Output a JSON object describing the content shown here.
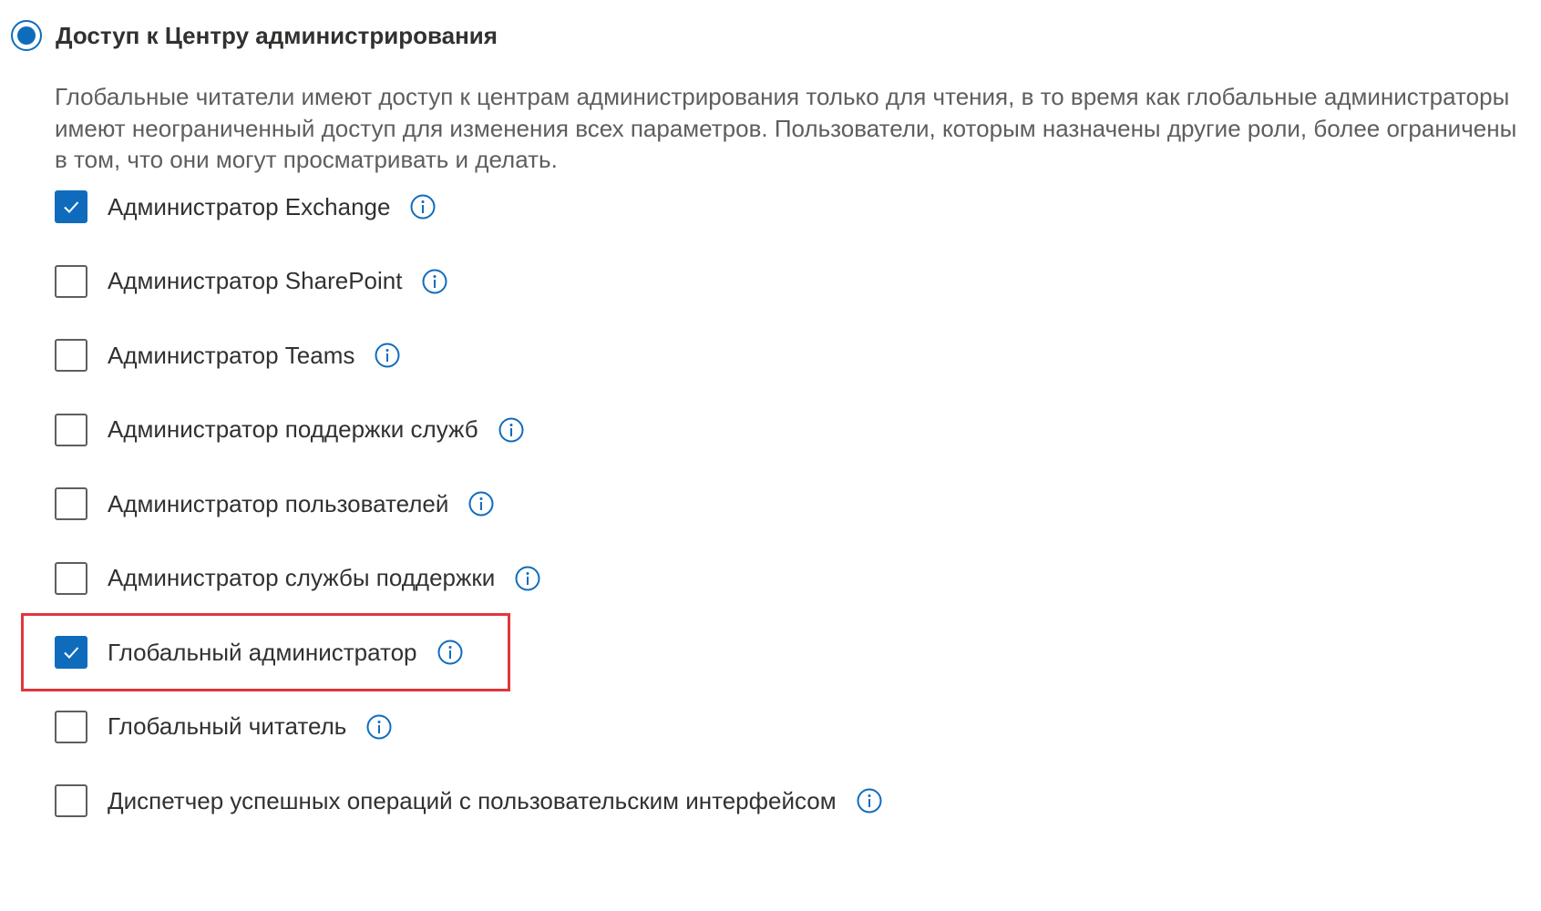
{
  "section": {
    "title": "Доступ к Центру администрирования",
    "selected": true,
    "description": "Глобальные читатели имеют доступ к центрам администрирования только для чтения, в то время как глобальные администраторы имеют неограниченный доступ для изменения всех параметров. Пользователи, которым назначены другие роли, более ограничены в том, что они могут просматривать и делать."
  },
  "roles": [
    {
      "label": "Администратор Exchange",
      "checked": true
    },
    {
      "label": "Администратор SharePoint",
      "checked": false
    },
    {
      "label": "Администратор Teams",
      "checked": false
    },
    {
      "label": "Администратор поддержки служб",
      "checked": false
    },
    {
      "label": "Администратор пользователей",
      "checked": false
    },
    {
      "label": "Администратор службы поддержки",
      "checked": false
    },
    {
      "label": "Глобальный администратор",
      "checked": true,
      "highlighted": true
    },
    {
      "label": "Глобальный читатель",
      "checked": false
    },
    {
      "label": "Диспетчер успешных операций с пользовательским интерфейсом",
      "checked": false
    }
  ],
  "colors": {
    "accent": "#0f6cbd",
    "highlight": "#e0363c",
    "text": "#323130",
    "secondary_text": "#605e5c"
  },
  "icons": {
    "radio": "radio-selected-icon",
    "checkbox": "checkmark-icon",
    "info": "info-icon"
  }
}
